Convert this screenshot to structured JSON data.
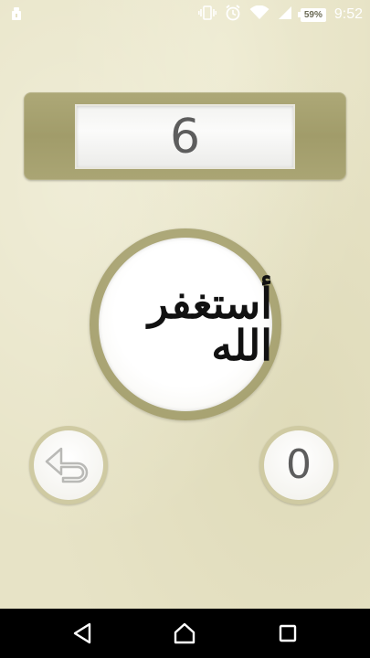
{
  "status_bar": {
    "time": "9:52",
    "battery_percent": "59%",
    "icons": [
      "android-debug-icon",
      "vibrate-icon",
      "alarm-icon",
      "wifi-icon",
      "signal-icon"
    ]
  },
  "counter": {
    "value": "6"
  },
  "tasbih": {
    "text": "أستغفر الله",
    "icon": "astaghfirullah-calligraphy"
  },
  "reset": {
    "icon": "undo-arrow-icon"
  },
  "total": {
    "value": "0"
  },
  "nav": {
    "back_icon": "back-icon",
    "home_icon": "home-icon",
    "recents_icon": "recents-icon"
  },
  "colors": {
    "background": "#e7e3c6",
    "panel": "#a7a270",
    "display": "#f6f6f4",
    "digits": "#5d5d5d"
  }
}
